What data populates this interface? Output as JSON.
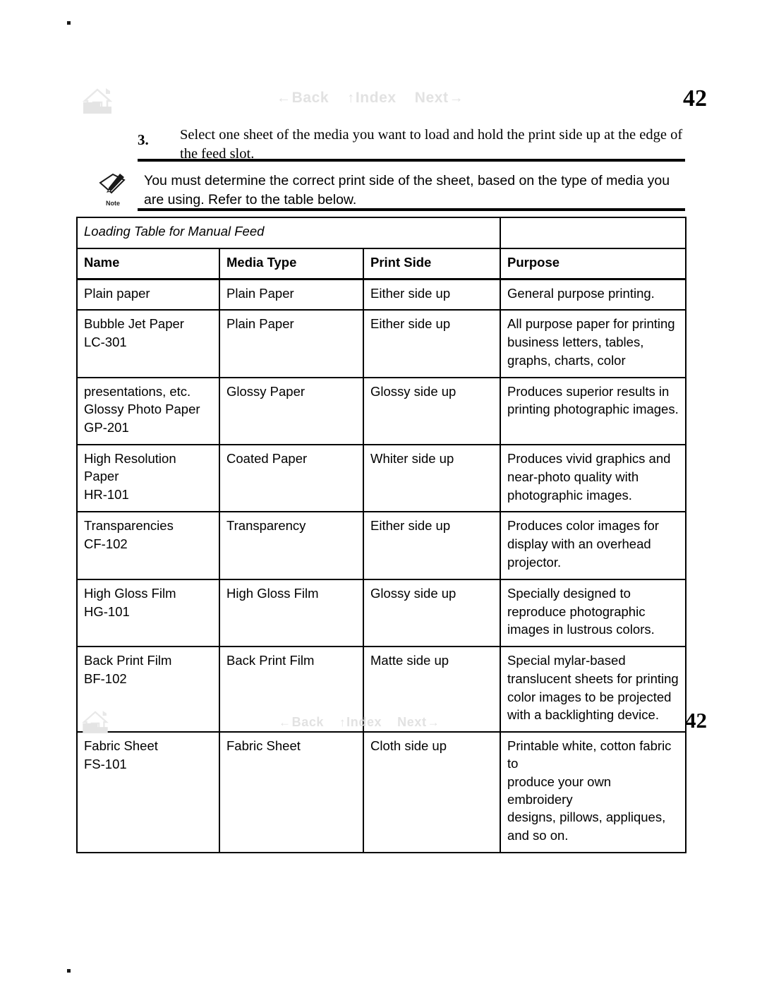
{
  "page": {
    "number": "42",
    "reg_marks": 2
  },
  "nav": {
    "home_icon": "home-icon",
    "links": [
      {
        "id": "back",
        "arrow": "←",
        "label": "Back",
        "arrow_side": "left"
      },
      {
        "id": "index",
        "arrow": "↑",
        "label": "Index",
        "arrow_side": "left"
      },
      {
        "id": "next",
        "arrow": "→",
        "label": "Next",
        "arrow_side": "right"
      }
    ],
    "link_color": "#e2e2e2"
  },
  "step": {
    "number": "3.",
    "text": "Select one sheet of the media you want to load and hold the print side up at the edge of the feed slot."
  },
  "note": {
    "icon": "note-pencil-icon",
    "icon_label": "Note",
    "text": "You must determine the correct print side of the sheet, based on the type of media you are using. Refer to the table below."
  },
  "table": {
    "title": "Loading Table for Manual Feed",
    "headers": [
      "Name",
      "Media Type",
      "Print Side",
      "Purpose"
    ],
    "rows": [
      {
        "name": [
          "Plain paper"
        ],
        "media_type": [
          "Plain Paper"
        ],
        "print_side": [
          "Either side up"
        ],
        "purpose": [
          "General purpose printing."
        ]
      },
      {
        "name": [
          "Bubble Jet Paper",
          "LC-301"
        ],
        "media_type": [
          "Plain Paper"
        ],
        "print_side": [
          "Either side up"
        ],
        "purpose": [
          "All purpose paper for printing",
          "business letters, tables,",
          "graphs, charts, color"
        ]
      },
      {
        "name": [
          "presentations, etc.",
          "Glossy Photo Paper",
          "GP-201"
        ],
        "media_type": [
          "Glossy Paper"
        ],
        "print_side": [
          "Glossy side up"
        ],
        "purpose": [
          "Produces superior results in",
          "printing photographic images."
        ]
      },
      {
        "name": [
          "High Resolution Paper",
          "HR-101"
        ],
        "media_type": [
          "Coated Paper"
        ],
        "print_side": [
          "Whiter side up"
        ],
        "purpose": [
          "Produces vivid graphics and",
          "near-photo quality with",
          "photographic images."
        ]
      },
      {
        "name": [
          "Transparencies",
          "CF-102"
        ],
        "media_type": [
          "Transparency"
        ],
        "print_side": [
          "Either side up"
        ],
        "purpose": [
          "Produces color images for",
          "display with an overhead",
          "projector."
        ]
      },
      {
        "name": [
          "High Gloss Film",
          "HG-101"
        ],
        "media_type": [
          "High Gloss Film"
        ],
        "print_side": [
          "Glossy side up"
        ],
        "purpose": [
          "Specially designed to",
          "reproduce photographic",
          "images in lustrous colors."
        ]
      },
      {
        "name": [
          "Back Print Film",
          "BF-102"
        ],
        "media_type": [
          "Back Print Film"
        ],
        "print_side": [
          "Matte side up"
        ],
        "purpose": [
          "Special mylar-based",
          "translucent sheets for printing",
          "color images to be projected",
          "with a backlighting device."
        ]
      },
      {
        "name": [
          "Fabric Sheet",
          "FS-101"
        ],
        "media_type": [
          "Fabric Sheet"
        ],
        "print_side": [
          "Cloth side up"
        ],
        "purpose": [
          "Printable white, cotton fabric to",
          "produce your own embroidery",
          "designs, pillows, appliques,",
          "and so on."
        ]
      }
    ]
  }
}
